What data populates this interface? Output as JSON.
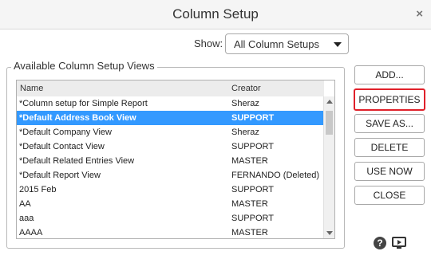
{
  "dialog": {
    "title": "Column Setup",
    "close_glyph": "×"
  },
  "show": {
    "label": "Show:",
    "selected": "All Column Setups"
  },
  "group": {
    "legend": "Available Column Setup Views"
  },
  "table": {
    "columns": [
      "Name",
      "Creator"
    ],
    "rows": [
      {
        "name": "*Column setup for Simple Report",
        "creator": "Sheraz"
      },
      {
        "name": "*Default Address Book View",
        "creator": "SUPPORT",
        "selected": true
      },
      {
        "name": "*Default Company View",
        "creator": "Sheraz"
      },
      {
        "name": "*Default Contact View",
        "creator": "SUPPORT"
      },
      {
        "name": "*Default Related Entries View",
        "creator": "MASTER"
      },
      {
        "name": "*Default Report View",
        "creator": "FERNANDO (Deleted)"
      },
      {
        "name": "2015 Feb",
        "creator": "SUPPORT"
      },
      {
        "name": "AA",
        "creator": "MASTER"
      },
      {
        "name": "aaa",
        "creator": "SUPPORT"
      },
      {
        "name": "AAAA",
        "creator": "MASTER"
      }
    ]
  },
  "buttons": {
    "add": "ADD...",
    "properties": "PROPERTIES",
    "save_as": "SAVE AS...",
    "delete": "DELETE",
    "use_now": "USE NOW",
    "close": "CLOSE"
  },
  "footer": {
    "help_glyph": "?"
  },
  "colors": {
    "selection": "#3399ff",
    "highlight_border": "#e0202a"
  },
  "icons": [
    "close-icon",
    "chevron-down-icon",
    "scroll-up-icon",
    "scroll-down-icon",
    "help-icon",
    "video-icon"
  ]
}
